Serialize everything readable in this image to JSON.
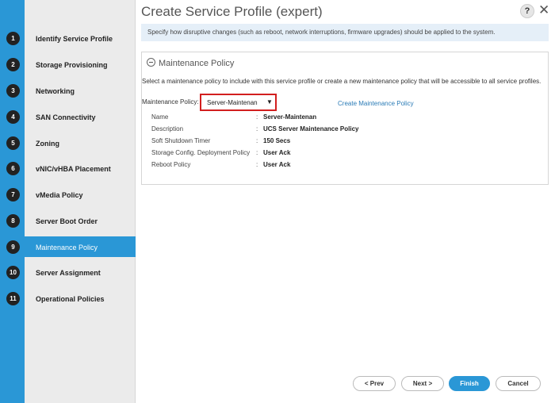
{
  "header": {
    "title": "Create Service Profile (expert)",
    "help": "?",
    "close": "✕"
  },
  "info": "Specify how disruptive changes (such as reboot, network interruptions, firmware upgrades) should be applied to the system.",
  "steps": [
    {
      "num": "1",
      "label": "Identify Service Profile"
    },
    {
      "num": "2",
      "label": "Storage Provisioning"
    },
    {
      "num": "3",
      "label": "Networking"
    },
    {
      "num": "4",
      "label": "SAN Connectivity"
    },
    {
      "num": "5",
      "label": "Zoning"
    },
    {
      "num": "6",
      "label": "vNIC/vHBA Placement"
    },
    {
      "num": "7",
      "label": "vMedia Policy"
    },
    {
      "num": "8",
      "label": "Server Boot Order"
    },
    {
      "num": "9",
      "label": "Maintenance Policy",
      "active": true
    },
    {
      "num": "10",
      "label": "Server Assignment"
    },
    {
      "num": "11",
      "label": "Operational Policies"
    }
  ],
  "section": {
    "title": "Maintenance Policy",
    "description": "Select a maintenance policy to include with this service profile or create a new maintenance policy that will be accessible to all service profiles.",
    "field_label": "Maintenance Policy:",
    "selected": "Server-Maintenan",
    "create_link": "Create Maintenance Policy",
    "details": [
      {
        "key": "Name",
        "value": "Server-Maintenan"
      },
      {
        "key": "Description",
        "value": "UCS Server Maintenance Policy"
      },
      {
        "key": "Soft Shutdown Timer",
        "value": "150 Secs"
      },
      {
        "key": "Storage Config. Deployment Policy",
        "value": "User Ack"
      },
      {
        "key": "Reboot Policy",
        "value": "User Ack"
      }
    ]
  },
  "footer": {
    "prev": "< Prev",
    "next": "Next >",
    "finish": "Finish",
    "cancel": "Cancel"
  },
  "colors": {
    "accent": "#2a97d6",
    "highlight_border": "#d21f1f",
    "link": "#2a7bb6"
  }
}
